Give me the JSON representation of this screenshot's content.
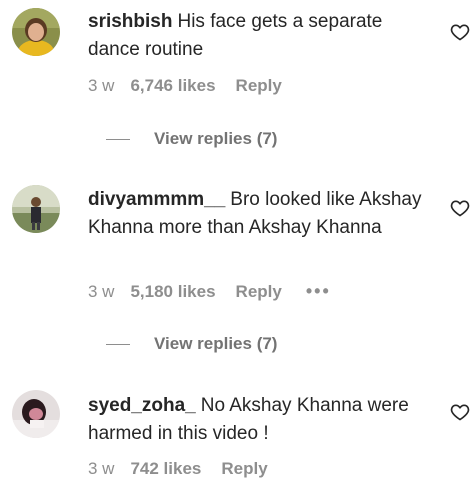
{
  "comments": [
    {
      "username": "srishbish",
      "text": "His face gets a separate dance routine",
      "time": "3 w",
      "likes": "6,746 likes",
      "reply": "Reply",
      "view_replies": "View replies (7)"
    },
    {
      "username": "divyammmm__",
      "text": "Bro looked like Akshay Khanna more than Akshay Khanna",
      "time": "3 w",
      "likes": "5,180 likes",
      "reply": "Reply",
      "more": "•••",
      "view_replies": "View replies (7)"
    },
    {
      "username": "syed_zoha_",
      "text": "No Akshay Khanna were harmed in this video !",
      "time": "3 w",
      "likes": "742 likes",
      "reply": "Reply"
    }
  ],
  "icons": {
    "like": "heart-outline-icon",
    "more": "more-options-icon"
  },
  "colors": {
    "text_primary": "#262626",
    "text_secondary": "#8e8e8e"
  }
}
